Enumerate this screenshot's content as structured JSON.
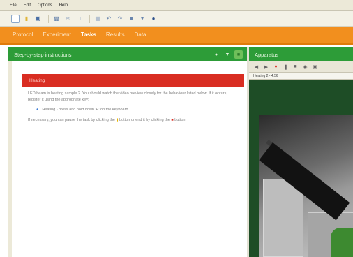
{
  "menubar": {
    "items": [
      "File",
      "Edit",
      "Options",
      "Help"
    ]
  },
  "toolbar": {
    "icons": [
      "new-file-icon",
      "open-folder-icon",
      "save-icon",
      "print-icon",
      "cut-icon",
      "copy-icon",
      "paste-icon",
      "undo-icon",
      "redo-icon",
      "stop-icon",
      "settings-icon",
      "help-icon"
    ]
  },
  "nav": {
    "items": [
      "Protocol",
      "Experiment",
      "Tasks",
      "Results",
      "Data"
    ],
    "active_index": 2
  },
  "instructions_panel": {
    "title": "Step-by-step instructions",
    "warning": "Heating",
    "para1": "LED beam is heating sample 2. You should watch the video preview closely for the behaviour listed below. If it occurs, register it using the appropriate key:",
    "bullet1": "Heating - press and hold down 'H' on the keyboard",
    "para2_prefix": "If necessary, you can pause the task by clicking the",
    "para2_mid": "button or end it by clicking the",
    "para2_suffix": "button."
  },
  "apparatus_panel": {
    "title": "Apparatus",
    "status": "Heating 2 - 4:56"
  },
  "colors": {
    "nav_orange": "#f28f1e",
    "panel_green": "#2d9c38",
    "warning_red": "#d92d22",
    "pause_yellow": "#e8b400"
  }
}
